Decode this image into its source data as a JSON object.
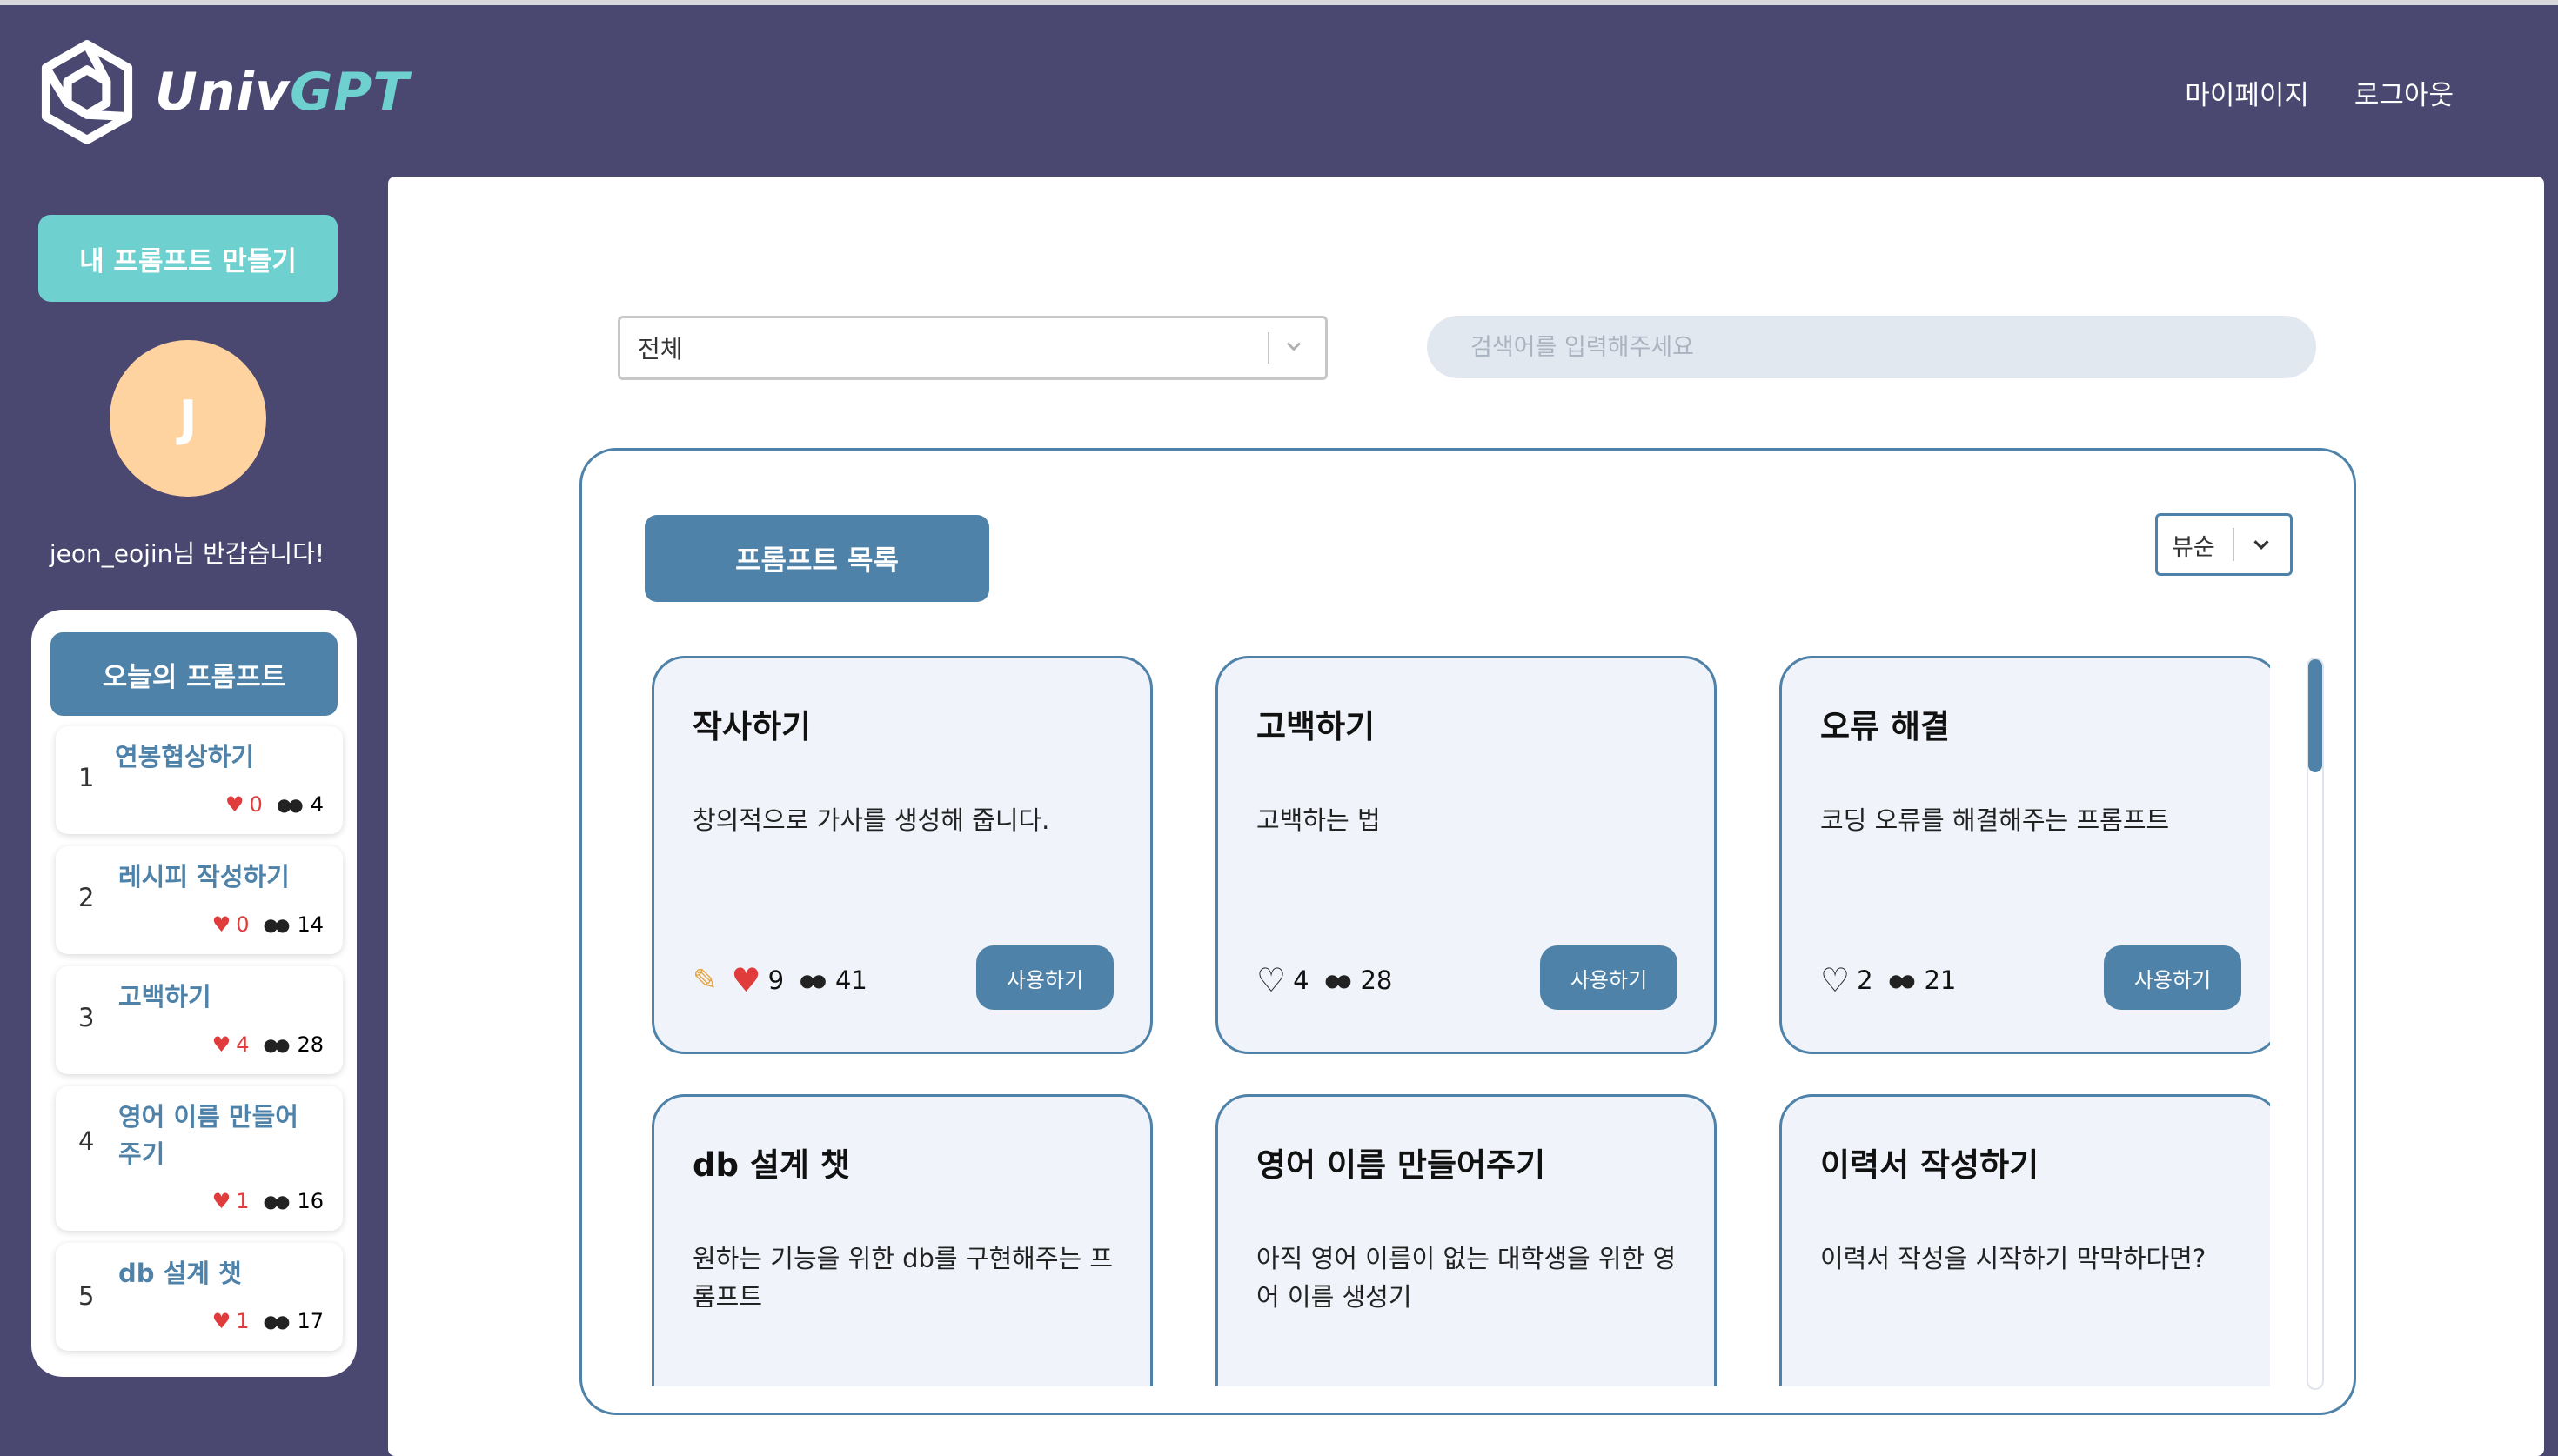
{
  "header": {
    "logo_primary": "Univ",
    "logo_accent": "GPT",
    "nav": [
      "마이페이지",
      "로그아웃"
    ]
  },
  "sidebar": {
    "create_button": "내 프롬프트 만들기",
    "avatar_initial": "J",
    "greeting": "jeon_eojin님 반갑습니다!",
    "today_title": "오늘의 프롬프트",
    "today_items": [
      {
        "rank": "1",
        "title": "연봉협상하기",
        "likes": "0",
        "views": "4"
      },
      {
        "rank": "2",
        "title": "레시피 작성하기",
        "likes": "0",
        "views": "14"
      },
      {
        "rank": "3",
        "title": "고백하기",
        "likes": "4",
        "views": "28"
      },
      {
        "rank": "4",
        "title": "영어 이름 만들어주기",
        "likes": "1",
        "views": "16"
      },
      {
        "rank": "5",
        "title": "db 설계 챗",
        "likes": "1",
        "views": "17"
      }
    ]
  },
  "filters": {
    "category_selected": "전체",
    "search_placeholder": "검색어를 입력해주세요"
  },
  "list": {
    "title": "프롬프트 목록",
    "sort_selected": "뷰순",
    "use_label": "사용하기",
    "cards": [
      {
        "title": "작사하기",
        "desc": "창의적으로 가사를 생성해 줍니다.",
        "likes": "9",
        "views": "41",
        "liked": true,
        "editable": true
      },
      {
        "title": "고백하기",
        "desc": "고백하는 법",
        "likes": "4",
        "views": "28",
        "liked": false,
        "editable": false
      },
      {
        "title": "오류 해결",
        "desc": "코딩 오류를 해결해주는 프롬프트",
        "likes": "2",
        "views": "21",
        "liked": false,
        "editable": false
      },
      {
        "title": "db 설계 챗",
        "desc": "원하는 기능을 위한 db를 구현해주는 프롬프트",
        "likes": "",
        "views": "",
        "liked": false,
        "editable": false
      },
      {
        "title": "영어 이름 만들어주기",
        "desc": "아직 영어 이름이 없는 대학생을 위한 영어 이름 생성기",
        "likes": "",
        "views": "",
        "liked": false,
        "editable": false
      },
      {
        "title": "이력서 작성하기",
        "desc": "이력서 작성을 시작하기 막막하다면?",
        "likes": "",
        "views": "",
        "liked": false,
        "editable": false
      }
    ]
  },
  "colors": {
    "background": "#4a4870",
    "accent_teal": "#6fd0d0",
    "primary_blue": "#4f82a8",
    "avatar": "#ffd3a0",
    "card_bg": "#f0f4fa",
    "heart": "#e03c3c"
  },
  "icons": [
    "logo-hexagon-icon",
    "chevron-down-icon",
    "heart-icon",
    "eyes-icon",
    "pencil-icon"
  ]
}
